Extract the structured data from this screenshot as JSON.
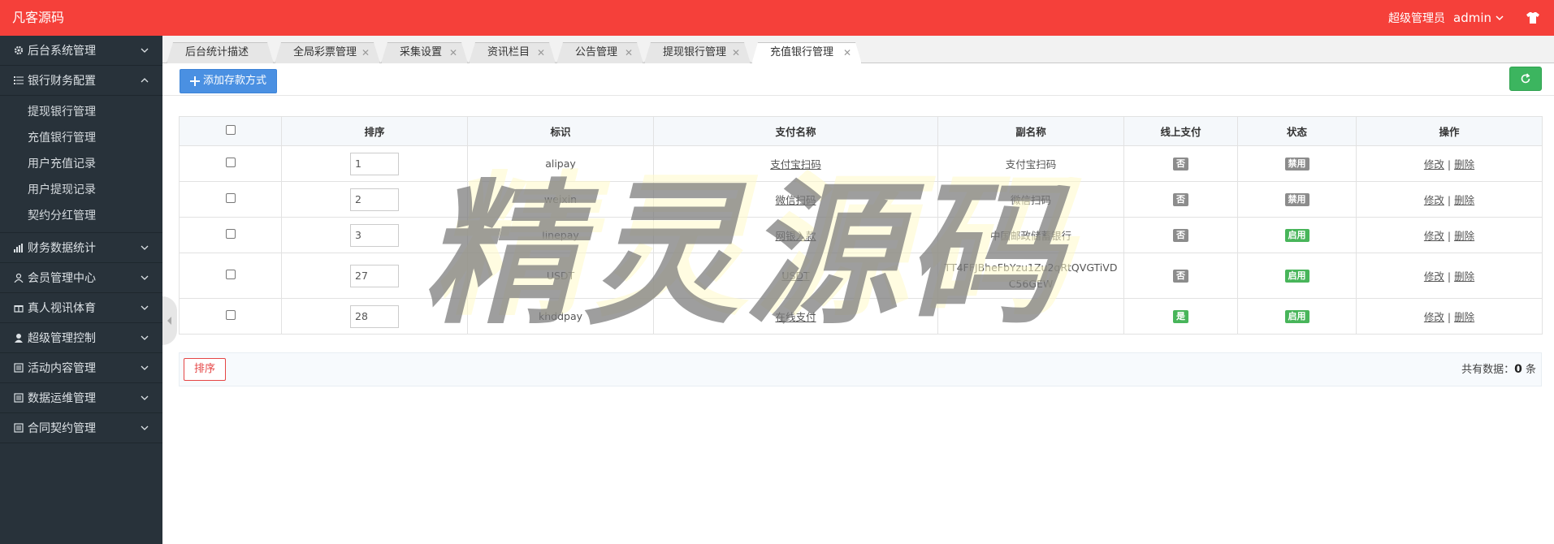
{
  "header": {
    "brand": "凡客源码",
    "role": "超级管理员",
    "user": "admin"
  },
  "sidebar": {
    "items": [
      {
        "label": "后台系统管理",
        "icon": "gear-icon",
        "expanded": false
      },
      {
        "label": "银行财务配置",
        "icon": "list-icon",
        "expanded": true,
        "children": [
          "提现银行管理",
          "充值银行管理",
          "用户充值记录",
          "用户提现记录",
          "契约分红管理"
        ]
      },
      {
        "label": "财务数据统计",
        "icon": "bar-chart-icon",
        "expanded": false
      },
      {
        "label": "会员管理中心",
        "icon": "user-icon",
        "expanded": false
      },
      {
        "label": "真人视讯体育",
        "icon": "gift-icon",
        "expanded": false
      },
      {
        "label": "超级管理控制",
        "icon": "admin-user-icon",
        "expanded": false
      },
      {
        "label": "活动内容管理",
        "icon": "doc-icon",
        "expanded": false
      },
      {
        "label": "数据运维管理",
        "icon": "doc-icon",
        "expanded": false
      },
      {
        "label": "合同契约管理",
        "icon": "doc-icon",
        "expanded": false
      }
    ]
  },
  "tabs": [
    {
      "label": "后台统计描述",
      "closable": false
    },
    {
      "label": "全局彩票管理",
      "closable": true
    },
    {
      "label": "采集设置",
      "closable": true
    },
    {
      "label": "资讯栏目",
      "closable": true
    },
    {
      "label": "公告管理",
      "closable": true
    },
    {
      "label": "提现银行管理",
      "closable": true
    },
    {
      "label": "充值银行管理",
      "closable": true,
      "active": true
    }
  ],
  "toolbar": {
    "add_label": "添加存款方式"
  },
  "table": {
    "headers": [
      "排序",
      "标识",
      "支付名称",
      "副名称",
      "线上支付",
      "状态",
      "操作"
    ],
    "rows": [
      {
        "sort": "1",
        "code": "alipay",
        "name": "支付宝扫码",
        "alias": "支付宝扫码",
        "online": "否",
        "status": "禁用"
      },
      {
        "sort": "2",
        "code": "weixin",
        "name": "微信扫码",
        "alias": "微信扫码",
        "online": "否",
        "status": "禁用"
      },
      {
        "sort": "3",
        "code": "linepay",
        "name": "网银入款",
        "alias": "中国邮政储蓄银行",
        "online": "否",
        "status": "启用"
      },
      {
        "sort": "27",
        "code": "USDT",
        "name": "USDT",
        "alias": "TT4FFJBheFbYzu1Zu2qRtQVGTiVDC56GEW",
        "online": "否",
        "status": "启用"
      },
      {
        "sort": "28",
        "code": "khddpay",
        "name": "在线支付",
        "alias": "",
        "online": "是",
        "status": "启用"
      }
    ],
    "op_edit": "修改",
    "op_sep": "|",
    "op_delete": "删除"
  },
  "footer": {
    "sort_button": "排序",
    "total_prefix": "共有数据：",
    "total_count": "0",
    "total_suffix": "条"
  },
  "watermark": {
    "text": "精灵源码"
  },
  "colors": {
    "header_bg": "#f5403a",
    "sidebar_bg": "#28323a",
    "add_button": "#4a90e2",
    "refresh_button": "#3cb55f",
    "badge_gray": "#8c8c8c",
    "badge_green": "#48b55a",
    "sort_button": "#e54545"
  }
}
